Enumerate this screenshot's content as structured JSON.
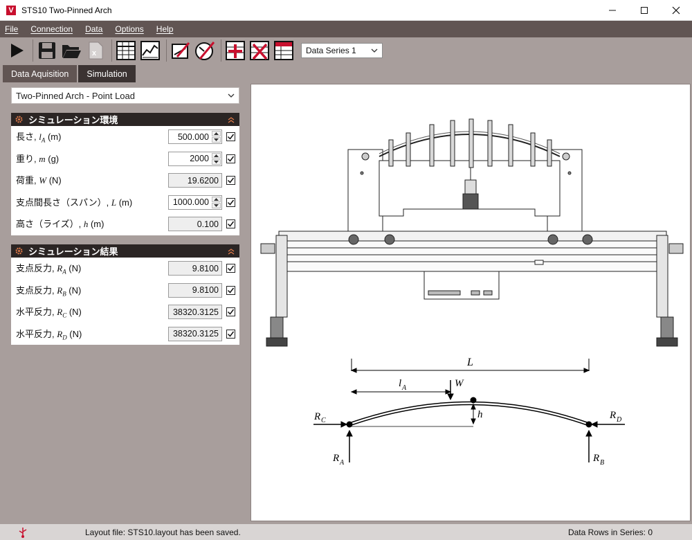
{
  "window": {
    "title": "STS10 Two-Pinned Arch",
    "app_icon_letter": "V"
  },
  "menu": [
    "File",
    "Connection",
    "Data",
    "Options",
    "Help"
  ],
  "toolbar": {
    "series_select": "Data Series 1"
  },
  "tabs": [
    {
      "label": "Data Aquisition",
      "active": false
    },
    {
      "label": "Simulation",
      "active": true
    }
  ],
  "left": {
    "config_select": "Two-Pinned Arch - Point Load",
    "env": {
      "header": "シミュレーション環境",
      "rows": [
        {
          "label": "長さ, ",
          "sym": "l",
          "sub": "A",
          "unit": " (m)",
          "value": "500.000",
          "spin": true
        },
        {
          "label": "重り, ",
          "sym": "m",
          "sub": "",
          "unit": " (g)",
          "value": "2000",
          "spin": true
        },
        {
          "label": "荷重, ",
          "sym": "W",
          "sub": "",
          "unit": " (N)",
          "value": "19.6200",
          "spin": false
        },
        {
          "label": "支点間長さ（スパン）, ",
          "sym": "L",
          "sub": "",
          "unit": " (m)",
          "value": "1000.000",
          "spin": true
        },
        {
          "label": "高さ（ライズ）, ",
          "sym": "h",
          "sub": "",
          "unit": " (m)",
          "value": "0.100",
          "spin": false
        }
      ]
    },
    "results": {
      "header": "シミュレーション結果",
      "rows": [
        {
          "label": "支点反力, ",
          "sym": "R",
          "sub": "A",
          "unit": " (N)",
          "value": "9.8100"
        },
        {
          "label": "支点反力, ",
          "sym": "R",
          "sub": "B",
          "unit": " (N)",
          "value": "9.8100"
        },
        {
          "label": "水平反力, ",
          "sym": "R",
          "sub": "C",
          "unit": " (N)",
          "value": "38320.3125"
        },
        {
          "label": "水平反力, ",
          "sym": "R",
          "sub": "D",
          "unit": " (N)",
          "value": "38320.3125"
        }
      ]
    }
  },
  "diagram": {
    "labels": {
      "L": "L",
      "lA": "l",
      "lA_sub": "A",
      "W": "W",
      "h": "h",
      "Rc": "R",
      "Rc_sub": "C",
      "Rd": "R",
      "Rd_sub": "D",
      "Ra": "R",
      "Ra_sub": "A",
      "Rb": "R",
      "Rb_sub": "B"
    }
  },
  "status": {
    "message": "Layout file: STS10.layout has been saved.",
    "rows": "Data Rows in Series: 0"
  }
}
